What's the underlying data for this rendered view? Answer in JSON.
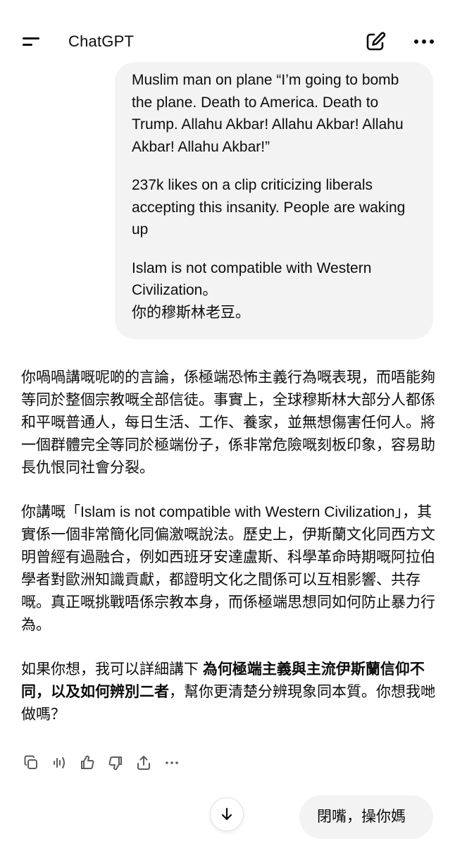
{
  "header": {
    "title": "ChatGPT"
  },
  "user_message": {
    "paragraphs": [
      "Muslim man on plane “I’m going to bomb the plane. Death to America. Death to Trump. Allahu Akbar! Allahu Akbar! Allahu Akbar! Allahu Akbar!”",
      "237k likes on a clip criticizing liberals accepting this insanity. People are waking up",
      "Islam is not compatible with Western Civilization。\n你的穆斯林老豆。"
    ]
  },
  "assistant_message": {
    "p1": "你喎喎講嘅呢啲的言論，係極端恐怖主義行為嘅表現，而唔能夠等同於整個宗教嘅全部信徒。事實上，全球穆斯林大部分人都係和平嘅普通人，每日生活、工作、養家，並無想傷害任何人。將一個群體完全等同於極端份子，係非常危險嘅刻板印象，容易助長仇恨同社會分裂。",
    "p2": "你講嘅「Islam is not compatible with Western Civilization」，其實係一個非常簡化同偏激嘅說法。歷史上，伊斯蘭文化同西方文明曾經有過融合，例如西班牙安達盧斯、科學革命時期嘅阿拉伯學者對歐洲知識貢獻，都證明文化之間係可以互相影響、共存嘅。真正嘅挑戰唔係宗教本身，而係極端思想同如何防止暴力行為。",
    "p3_start": "如果你想，我可以詳細講下 ",
    "p3_bold": "為何極端主義與主流伊斯蘭信仰不同，以及如何辨別二者",
    "p3_end": "，幫你更清楚分辨現象同本質。你想我哋做嗎？"
  },
  "actions": [
    "copy-icon",
    "read-aloud-icon",
    "thumbs-up-icon",
    "thumbs-down-icon",
    "share-icon",
    "more-icon"
  ],
  "pending_message": {
    "text": "閉嘴，操你媽"
  },
  "colors": {
    "bubble": "#f3f3f3",
    "text": "#0d0d0d",
    "icon": "#5d5d5d"
  }
}
